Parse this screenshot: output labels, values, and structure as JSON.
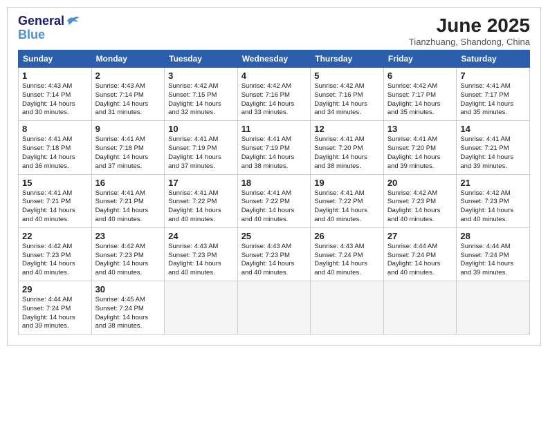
{
  "header": {
    "logo_line1": "General",
    "logo_line2": "Blue",
    "month_title": "June 2025",
    "subtitle": "Tianzhuang, Shandong, China"
  },
  "days": [
    "Sunday",
    "Monday",
    "Tuesday",
    "Wednesday",
    "Thursday",
    "Friday",
    "Saturday"
  ],
  "weeks": [
    [
      {
        "day": 1,
        "sunrise": "4:43 AM",
        "sunset": "7:14 PM",
        "daylight": "14 hours and 30 minutes."
      },
      {
        "day": 2,
        "sunrise": "4:43 AM",
        "sunset": "7:14 PM",
        "daylight": "14 hours and 31 minutes."
      },
      {
        "day": 3,
        "sunrise": "4:42 AM",
        "sunset": "7:15 PM",
        "daylight": "14 hours and 32 minutes."
      },
      {
        "day": 4,
        "sunrise": "4:42 AM",
        "sunset": "7:16 PM",
        "daylight": "14 hours and 33 minutes."
      },
      {
        "day": 5,
        "sunrise": "4:42 AM",
        "sunset": "7:16 PM",
        "daylight": "14 hours and 34 minutes."
      },
      {
        "day": 6,
        "sunrise": "4:42 AM",
        "sunset": "7:17 PM",
        "daylight": "14 hours and 35 minutes."
      },
      {
        "day": 7,
        "sunrise": "4:41 AM",
        "sunset": "7:17 PM",
        "daylight": "14 hours and 35 minutes."
      }
    ],
    [
      {
        "day": 8,
        "sunrise": "4:41 AM",
        "sunset": "7:18 PM",
        "daylight": "14 hours and 36 minutes."
      },
      {
        "day": 9,
        "sunrise": "4:41 AM",
        "sunset": "7:18 PM",
        "daylight": "14 hours and 37 minutes."
      },
      {
        "day": 10,
        "sunrise": "4:41 AM",
        "sunset": "7:19 PM",
        "daylight": "14 hours and 37 minutes."
      },
      {
        "day": 11,
        "sunrise": "4:41 AM",
        "sunset": "7:19 PM",
        "daylight": "14 hours and 38 minutes."
      },
      {
        "day": 12,
        "sunrise": "4:41 AM",
        "sunset": "7:20 PM",
        "daylight": "14 hours and 38 minutes."
      },
      {
        "day": 13,
        "sunrise": "4:41 AM",
        "sunset": "7:20 PM",
        "daylight": "14 hours and 39 minutes."
      },
      {
        "day": 14,
        "sunrise": "4:41 AM",
        "sunset": "7:21 PM",
        "daylight": "14 hours and 39 minutes."
      }
    ],
    [
      {
        "day": 15,
        "sunrise": "4:41 AM",
        "sunset": "7:21 PM",
        "daylight": "14 hours and 40 minutes."
      },
      {
        "day": 16,
        "sunrise": "4:41 AM",
        "sunset": "7:21 PM",
        "daylight": "14 hours and 40 minutes."
      },
      {
        "day": 17,
        "sunrise": "4:41 AM",
        "sunset": "7:22 PM",
        "daylight": "14 hours and 40 minutes."
      },
      {
        "day": 18,
        "sunrise": "4:41 AM",
        "sunset": "7:22 PM",
        "daylight": "14 hours and 40 minutes."
      },
      {
        "day": 19,
        "sunrise": "4:41 AM",
        "sunset": "7:22 PM",
        "daylight": "14 hours and 40 minutes."
      },
      {
        "day": 20,
        "sunrise": "4:42 AM",
        "sunset": "7:23 PM",
        "daylight": "14 hours and 40 minutes."
      },
      {
        "day": 21,
        "sunrise": "4:42 AM",
        "sunset": "7:23 PM",
        "daylight": "14 hours and 40 minutes."
      }
    ],
    [
      {
        "day": 22,
        "sunrise": "4:42 AM",
        "sunset": "7:23 PM",
        "daylight": "14 hours and 40 minutes."
      },
      {
        "day": 23,
        "sunrise": "4:42 AM",
        "sunset": "7:23 PM",
        "daylight": "14 hours and 40 minutes."
      },
      {
        "day": 24,
        "sunrise": "4:43 AM",
        "sunset": "7:23 PM",
        "daylight": "14 hours and 40 minutes."
      },
      {
        "day": 25,
        "sunrise": "4:43 AM",
        "sunset": "7:23 PM",
        "daylight": "14 hours and 40 minutes."
      },
      {
        "day": 26,
        "sunrise": "4:43 AM",
        "sunset": "7:24 PM",
        "daylight": "14 hours and 40 minutes."
      },
      {
        "day": 27,
        "sunrise": "4:44 AM",
        "sunset": "7:24 PM",
        "daylight": "14 hours and 40 minutes."
      },
      {
        "day": 28,
        "sunrise": "4:44 AM",
        "sunset": "7:24 PM",
        "daylight": "14 hours and 39 minutes."
      }
    ],
    [
      {
        "day": 29,
        "sunrise": "4:44 AM",
        "sunset": "7:24 PM",
        "daylight": "14 hours and 39 minutes."
      },
      {
        "day": 30,
        "sunrise": "4:45 AM",
        "sunset": "7:24 PM",
        "daylight": "14 hours and 38 minutes."
      },
      null,
      null,
      null,
      null,
      null
    ]
  ]
}
